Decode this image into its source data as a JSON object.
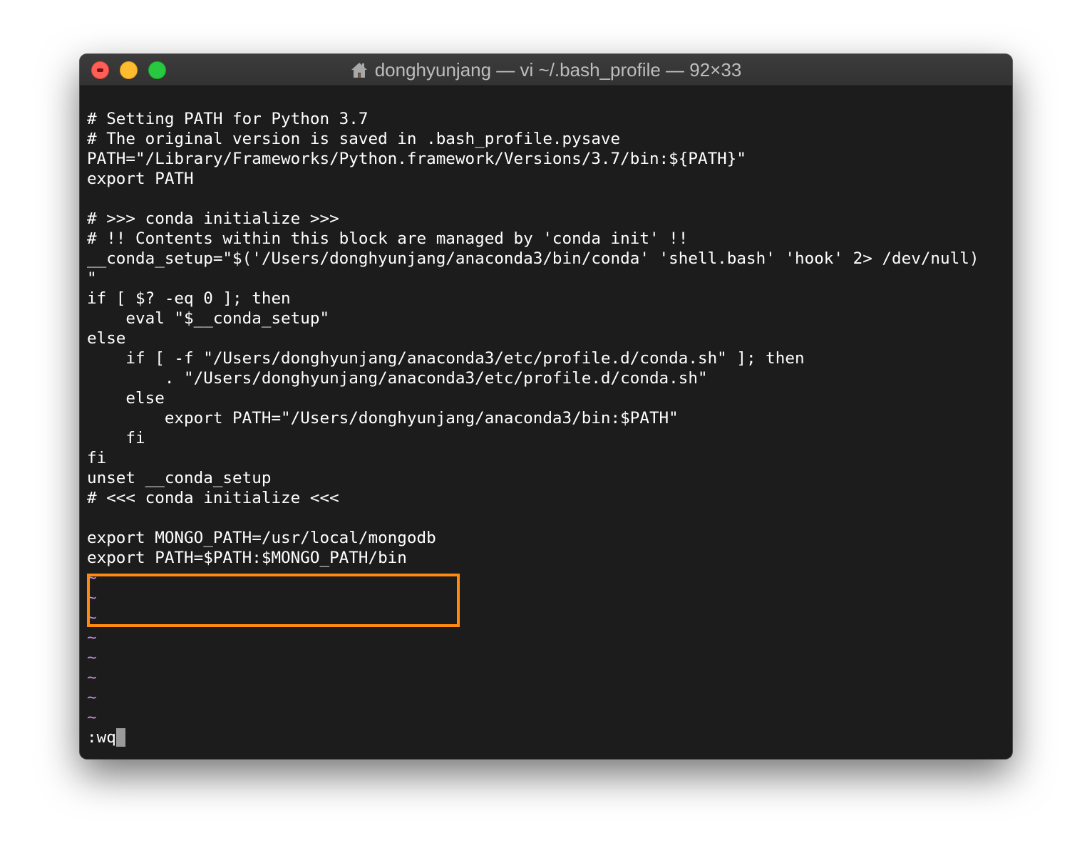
{
  "window": {
    "title": "donghyunjang — vi ~/.bash_profile — 92×33",
    "icons": {
      "title_icon": "home-icon"
    }
  },
  "editor": {
    "lines": [
      "# Setting PATH for Python 3.7",
      "# The original version is saved in .bash_profile.pysave",
      "PATH=\"/Library/Frameworks/Python.framework/Versions/3.7/bin:${PATH}\"",
      "export PATH",
      "",
      "# >>> conda initialize >>>",
      "# !! Contents within this block are managed by 'conda init' !!",
      "__conda_setup=\"$('/Users/donghyunjang/anaconda3/bin/conda' 'shell.bash' 'hook' 2> /dev/null)",
      "\"",
      "if [ $? -eq 0 ]; then",
      "    eval \"$__conda_setup\"",
      "else",
      "    if [ -f \"/Users/donghyunjang/anaconda3/etc/profile.d/conda.sh\" ]; then",
      "        . \"/Users/donghyunjang/anaconda3/etc/profile.d/conda.sh\"",
      "    else",
      "        export PATH=\"/Users/donghyunjang/anaconda3/bin:$PATH\"",
      "    fi",
      "fi",
      "unset __conda_setup",
      "# <<< conda initialize <<<",
      "",
      "export MONGO_PATH=/usr/local/mongodb",
      "export PATH=$PATH:$MONGO_PATH/bin"
    ],
    "empty_line_marker": "~",
    "command_line": ":wq"
  },
  "colors": {
    "background": "#1c1c1c",
    "text": "#ffffff",
    "tilde": "#c68ee0",
    "highlight": "#ff8a0d"
  }
}
